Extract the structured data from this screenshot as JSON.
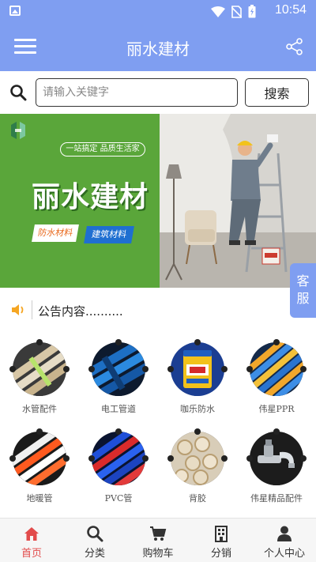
{
  "status_bar": {
    "time": "10:54",
    "icons": [
      "image-icon",
      "wifi-icon",
      "no-sim-icon",
      "battery-icon"
    ]
  },
  "app_bar": {
    "title": "丽水建材",
    "menu_icon": "menu-icon",
    "share_icon": "share-icon"
  },
  "search": {
    "placeholder": "请输入关键字",
    "value": "",
    "button_label": "搜索"
  },
  "banner": {
    "tagline": "一站搞定 品质生活家",
    "brand": "丽水建材",
    "tags": [
      "防水材料",
      "建筑材料"
    ]
  },
  "side_button": {
    "label": "客服"
  },
  "notice": {
    "text": "公告内容.........."
  },
  "categories": [
    {
      "label": "水管配件",
      "theme": "tan"
    },
    {
      "label": "电工管道",
      "theme": "blue"
    },
    {
      "label": "咖乐防水",
      "theme": "bucket"
    },
    {
      "label": "伟星PPR",
      "theme": "yellow"
    },
    {
      "label": "地暖管",
      "theme": "orange"
    },
    {
      "label": "PVC管",
      "theme": "pvcblue"
    },
    {
      "label": "背胶",
      "theme": "roll"
    },
    {
      "label": "伟星精品配件",
      "theme": "faucet"
    }
  ],
  "tabs": [
    {
      "label": "首页",
      "icon": "home-icon",
      "active": true
    },
    {
      "label": "分类",
      "icon": "search-icon",
      "active": false
    },
    {
      "label": "购物车",
      "icon": "cart-icon",
      "active": false
    },
    {
      "label": "分销",
      "icon": "building-icon",
      "active": false
    },
    {
      "label": "个人中心",
      "icon": "person-icon",
      "active": false
    }
  ],
  "colors": {
    "primary": "#7f9ef1",
    "active_tab": "#e24b4b",
    "banner_green": "#5aa63a"
  }
}
